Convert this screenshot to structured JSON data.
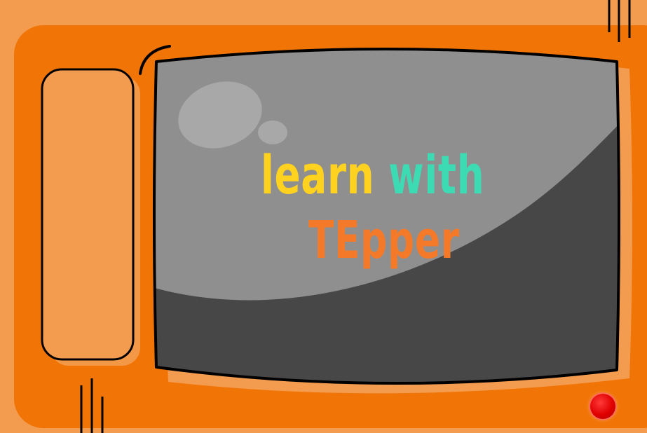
{
  "title": {
    "word1": "learn",
    "word2": "with",
    "word3": "TEpper"
  },
  "colors": {
    "background": "#f39c4f",
    "tv_body": "#f17407",
    "tv_body_light": "#f39c4f",
    "screen_light": "#8f8f8f",
    "screen_dark": "#474747",
    "outline": "#000000",
    "word1": "#ffd21f",
    "word2": "#3ddbb4",
    "word3": "#f47a2a",
    "power": "#e00000"
  },
  "icons": {
    "power": "power-button-icon"
  }
}
